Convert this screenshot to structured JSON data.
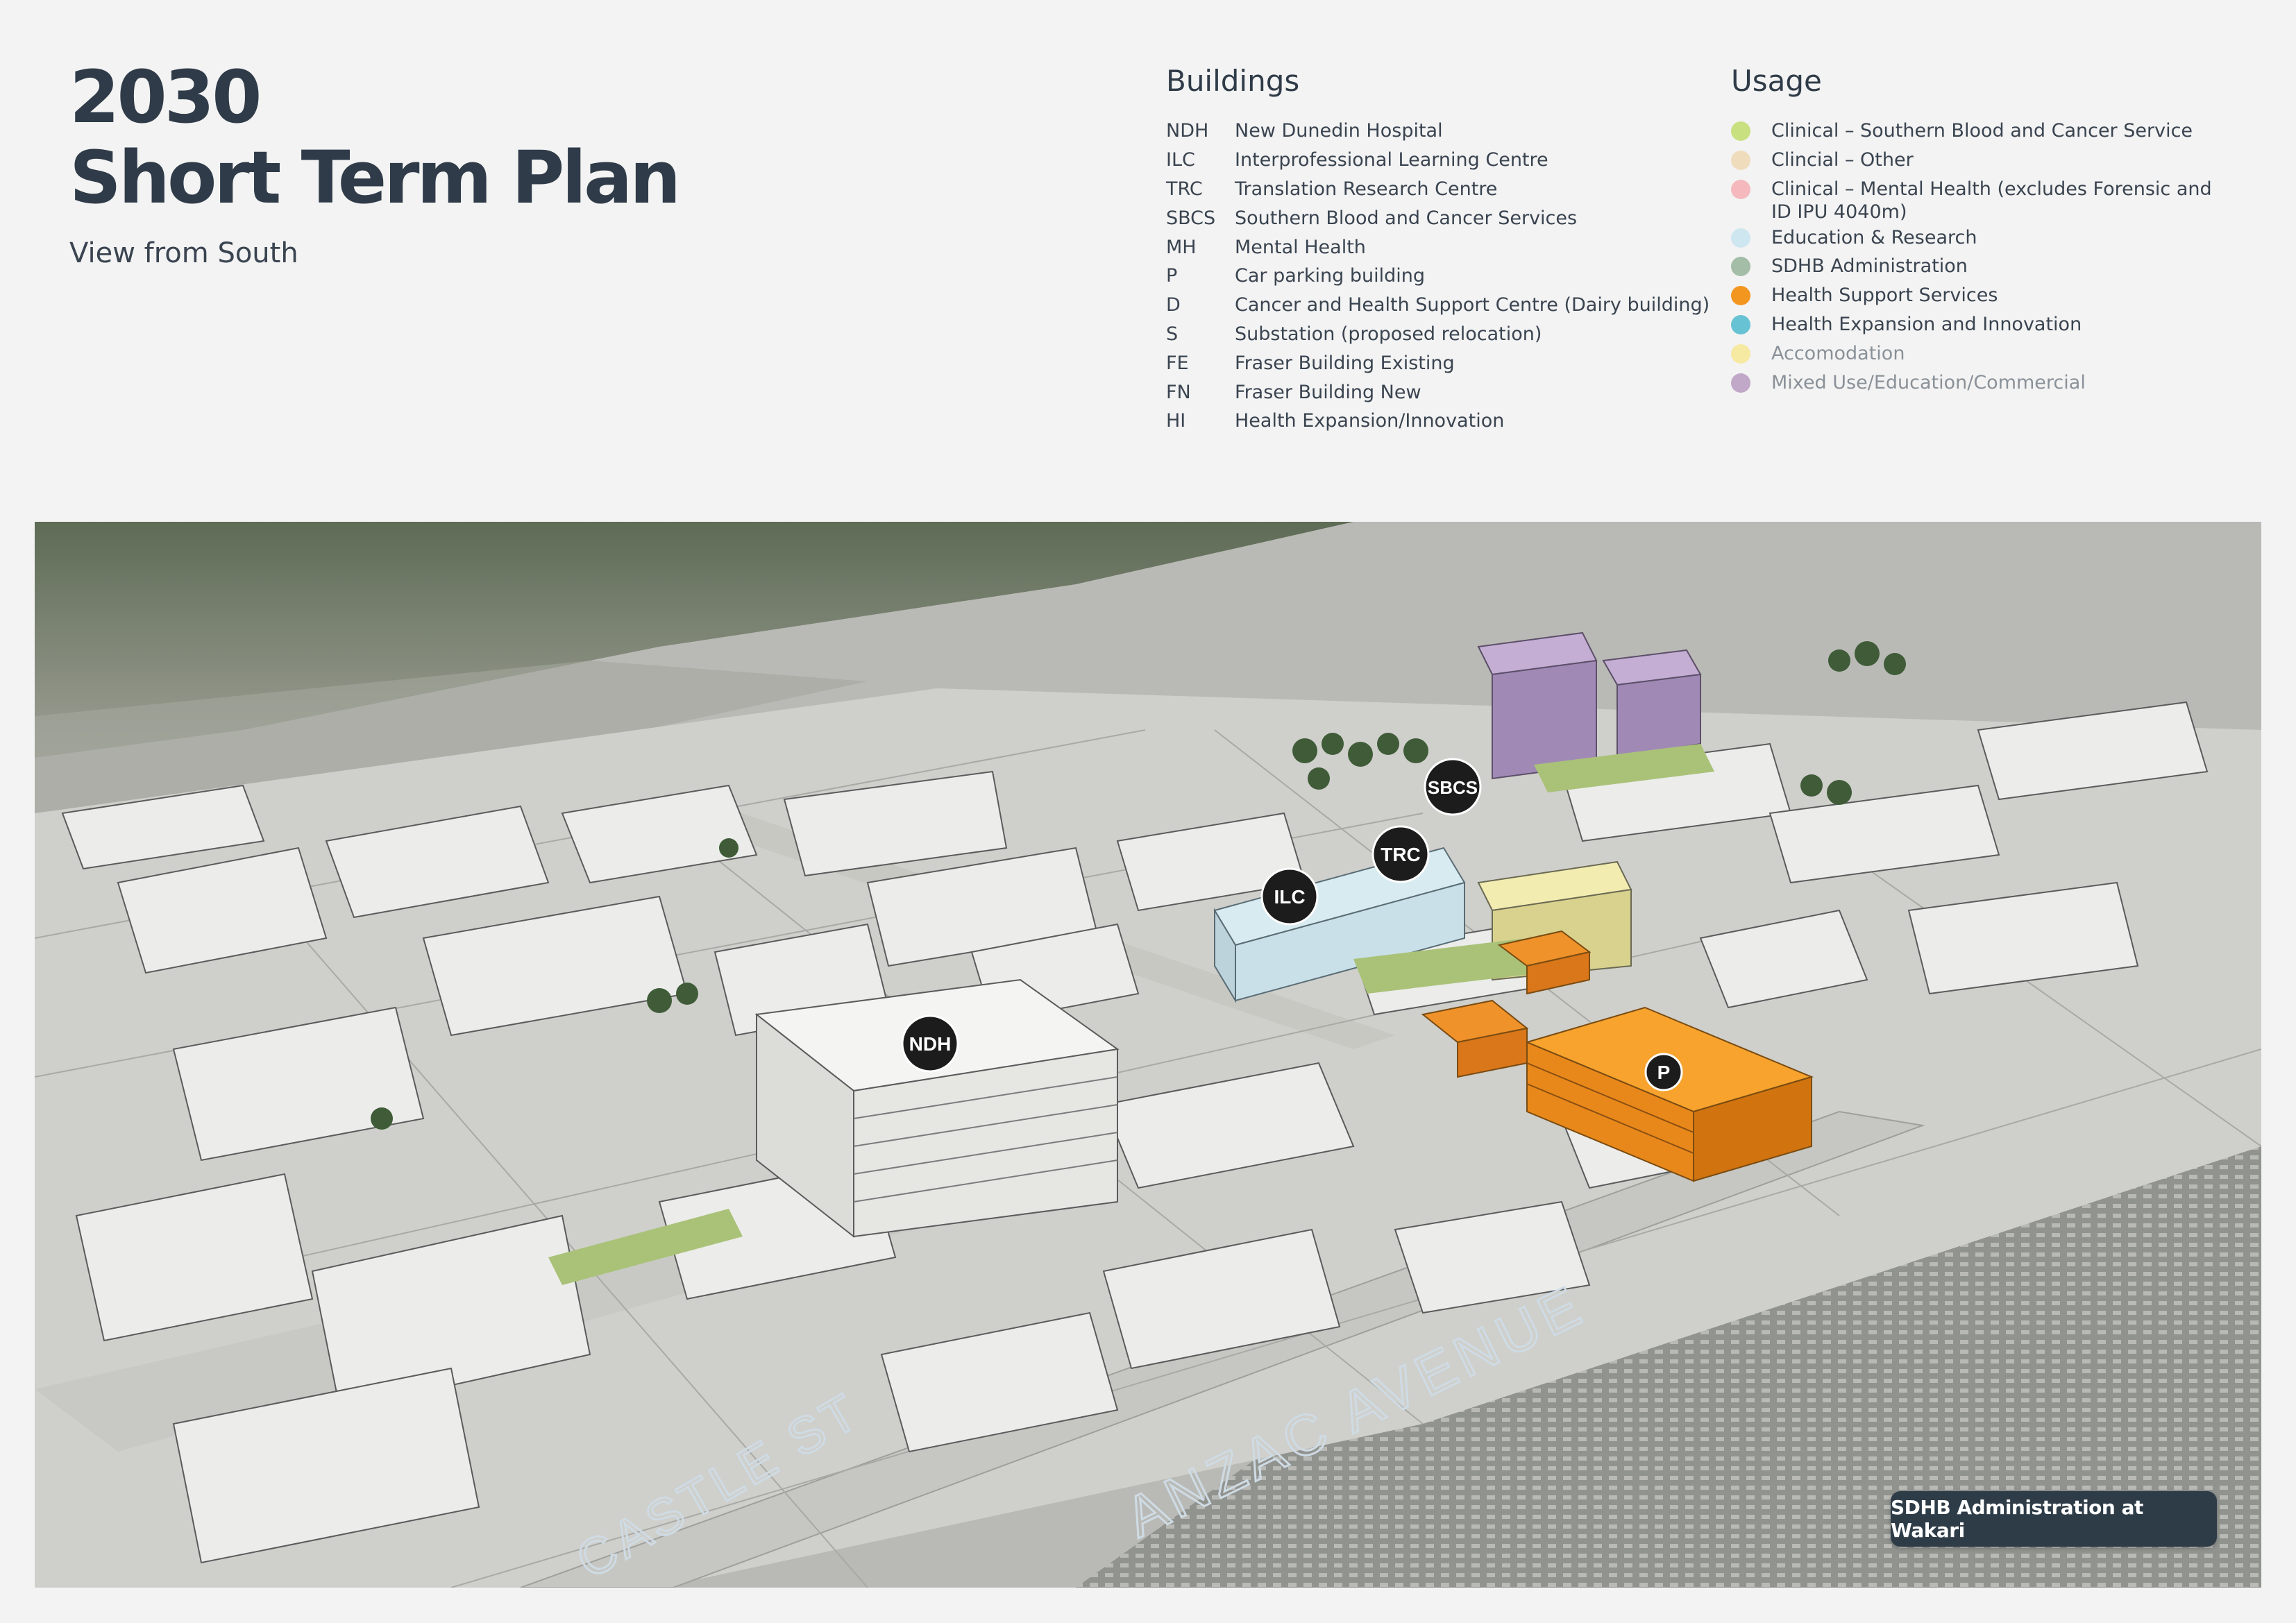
{
  "header": {
    "title_line1": "2030",
    "title_line2": "Short Term Plan",
    "subtitle": "View from South"
  },
  "buildings": {
    "heading": "Buildings",
    "items": [
      {
        "code": "NDH",
        "name": "New Dunedin Hospital"
      },
      {
        "code": "ILC",
        "name": "Interprofessional Learning Centre"
      },
      {
        "code": "TRC",
        "name": "Translation Research Centre"
      },
      {
        "code": "SBCS",
        "name": "Southern Blood and Cancer Services"
      },
      {
        "code": "MH",
        "name": "Mental Health"
      },
      {
        "code": "P",
        "name": "Car parking building"
      },
      {
        "code": "D",
        "name": "Cancer and Health Support Centre (Dairy building)"
      },
      {
        "code": "S",
        "name": "Substation (proposed relocation)"
      },
      {
        "code": "FE",
        "name": "Fraser Building Existing"
      },
      {
        "code": "FN",
        "name": "Fraser Building New"
      },
      {
        "code": "HI",
        "name": "Health Expansion/Innovation"
      }
    ]
  },
  "usage": {
    "heading": "Usage",
    "items": [
      {
        "label": "Clinical – Southern Blood and Cancer Service",
        "color": "#c8e07f",
        "muted": false
      },
      {
        "label": "Clincial – Other",
        "color": "#efdcbd",
        "muted": false
      },
      {
        "label": "Clinical – Mental Health (excludes Forensic and ID IPU 4040m)",
        "color": "#f5b9bd",
        "muted": false
      },
      {
        "label": "Education & Research",
        "color": "#cde6ef",
        "muted": false
      },
      {
        "label": "SDHB Administration",
        "color": "#a3bda6",
        "muted": false
      },
      {
        "label": "Health Support Services",
        "color": "#f2961f",
        "muted": false
      },
      {
        "label": "Health Expansion and Innovation",
        "color": "#67c2d3",
        "muted": false
      },
      {
        "label": "Accomodation",
        "color": "#f6e9a2",
        "muted": true
      },
      {
        "label": "Mixed Use/Education/Commercial",
        "color": "#c1a7c8",
        "muted": true
      }
    ]
  },
  "map": {
    "markers": [
      {
        "code": "NDH"
      },
      {
        "code": "ILC"
      },
      {
        "code": "TRC"
      },
      {
        "code": "SBCS"
      },
      {
        "code": "P"
      }
    ],
    "streets": {
      "castle": "CASTLE ST",
      "anzac": "ANZAC AVENUE"
    },
    "wakari_label": "SDHB Administration at Wakari"
  }
}
